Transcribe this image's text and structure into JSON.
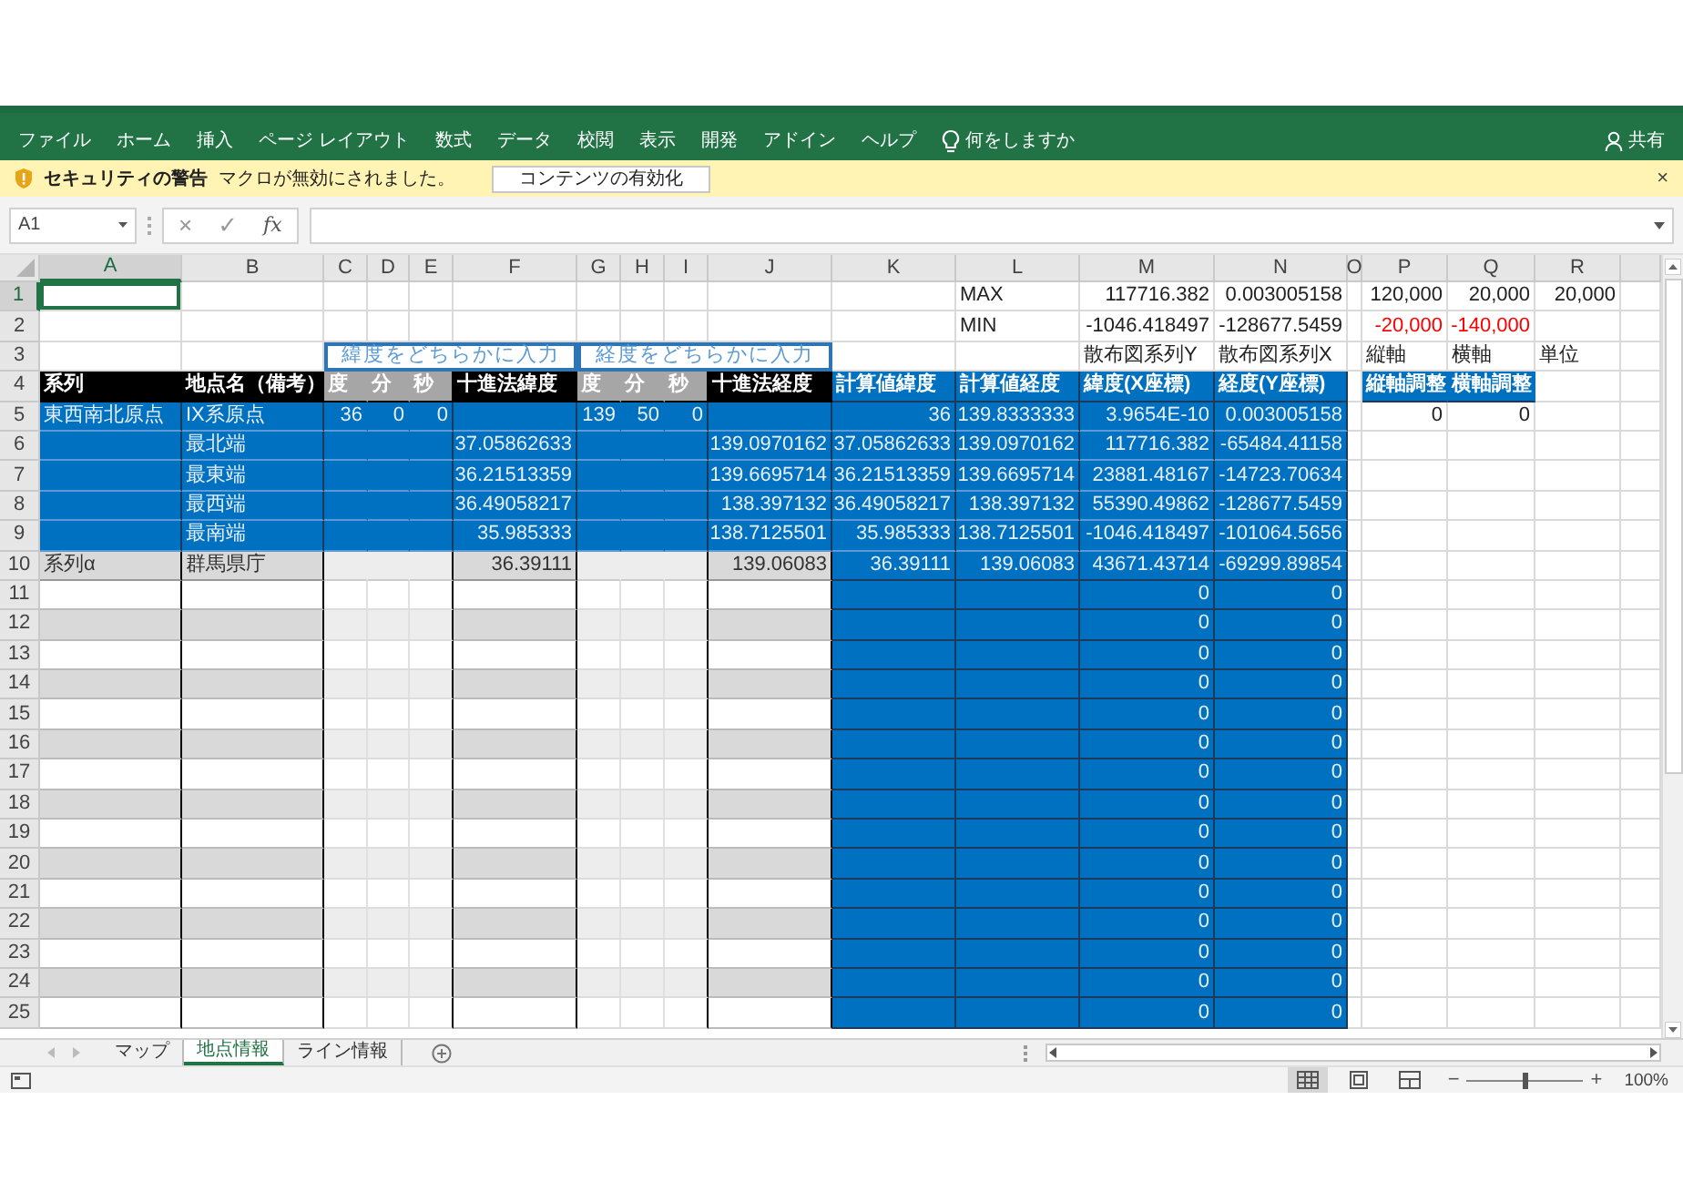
{
  "ribbon": {
    "tabs": [
      "ファイル",
      "ホーム",
      "挿入",
      "ページ レイアウト",
      "数式",
      "データ",
      "校閲",
      "表示",
      "開発",
      "アドイン",
      "ヘルプ"
    ],
    "tell_me": "何をしますか",
    "share": "共有"
  },
  "security_bar": {
    "title": "セキュリティの警告",
    "message": "マクロが無効にされました。",
    "button": "コンテンツの有効化",
    "close": "×"
  },
  "formula_bar": {
    "name_box": "A1",
    "cancel": "×",
    "enter": "✓",
    "function": "fx"
  },
  "sheet": {
    "columns": [
      {
        "letter": "A",
        "kind": "name",
        "selected": true
      },
      {
        "letter": "B",
        "kind": "name",
        "selected": false
      },
      {
        "letter": "C",
        "kind": "dms",
        "selected": false
      },
      {
        "letter": "D",
        "kind": "dms",
        "selected": false
      },
      {
        "letter": "E",
        "kind": "dms",
        "selected": false
      },
      {
        "letter": "F",
        "kind": "decimal",
        "selected": false
      },
      {
        "letter": "G",
        "kind": "dms",
        "selected": false
      },
      {
        "letter": "H",
        "kind": "dms",
        "selected": false
      },
      {
        "letter": "I",
        "kind": "dms",
        "selected": false
      },
      {
        "letter": "J",
        "kind": "decimal",
        "selected": false
      },
      {
        "letter": "K",
        "kind": "calc",
        "selected": false
      },
      {
        "letter": "L",
        "kind": "calc",
        "selected": false
      },
      {
        "letter": "M",
        "kind": "calc",
        "selected": false
      },
      {
        "letter": "N",
        "kind": "calc",
        "selected": false
      },
      {
        "letter": "O",
        "kind": "gap",
        "selected": false
      },
      {
        "letter": "P",
        "kind": "axis",
        "selected": false
      },
      {
        "letter": "Q",
        "kind": "axis",
        "selected": false
      },
      {
        "letter": "R",
        "kind": "plain",
        "selected": false
      }
    ],
    "rows": [
      {
        "number": "1",
        "kind": "plain",
        "selected": true,
        "cells": [
          "",
          "",
          "",
          "",
          "",
          "",
          "",
          "",
          "",
          "",
          "",
          {
            "text": "MAX",
            "kind": "label"
          },
          "117716.382",
          "0.003005158",
          "",
          "120,000",
          "20,000",
          "20,000"
        ]
      },
      {
        "number": "2",
        "kind": "plain",
        "selected": false,
        "cells": [
          "",
          "",
          "",
          "",
          "",
          "",
          "",
          "",
          "",
          "",
          "",
          {
            "text": "MIN",
            "kind": "label"
          },
          "-1046.418497",
          "-128677.5459",
          "",
          {
            "text": "-20,000",
            "color": "#ff0000"
          },
          {
            "text": "-140,000",
            "color": "#ff0000"
          },
          ""
        ]
      },
      {
        "number": "3",
        "kind": "label",
        "selected": false,
        "cells": [
          "",
          "",
          {
            "text": "緯度をどちらかに入力",
            "kind": "banner"
          },
          {
            "kind": "merged"
          },
          {
            "kind": "merged"
          },
          {
            "kind": "merged"
          },
          {
            "text": "経度をどちらかに入力",
            "kind": "banner"
          },
          {
            "kind": "merged"
          },
          {
            "kind": "merged"
          },
          {
            "kind": "merged"
          },
          "",
          "",
          "散布図系列Y",
          "散布図系列X",
          "",
          "縦軸",
          "横軸",
          "単位"
        ]
      },
      {
        "number": "4",
        "kind": "header",
        "selected": false,
        "cells": [
          "系列",
          "地点名（備考）",
          "度",
          "分",
          "秒",
          "十進法緯度",
          "度",
          "分",
          "秒",
          "十進法経度",
          "計算値緯度",
          "計算値経度",
          "緯度(X座標)",
          "経度(Y座標)",
          "",
          "縦軸調整",
          "横軸調整",
          ""
        ]
      },
      {
        "number": "5",
        "kind": "series",
        "selected": false,
        "cells": [
          "東西南北原点",
          "IX系原点",
          "36",
          "0",
          "0",
          "",
          "139",
          "50",
          "0",
          "",
          "36",
          "139.8333333",
          "3.9654E-10",
          "0.003005158",
          "",
          "0",
          "0",
          ""
        ]
      },
      {
        "number": "6",
        "kind": "series",
        "selected": false,
        "cells": [
          "",
          "最北端",
          "",
          "",
          "",
          "37.05862633",
          "",
          "",
          "",
          "139.0970162",
          "37.05862633",
          "139.0970162",
          "117716.382",
          "-65484.41158",
          "",
          "",
          "",
          ""
        ]
      },
      {
        "number": "7",
        "kind": "series",
        "selected": false,
        "cells": [
          "",
          "最東端",
          "",
          "",
          "",
          "36.21513359",
          "",
          "",
          "",
          "139.6695714",
          "36.21513359",
          "139.6695714",
          "23881.48167",
          "-14723.70634",
          "",
          "",
          "",
          ""
        ]
      },
      {
        "number": "8",
        "kind": "series",
        "selected": false,
        "cells": [
          "",
          "最西端",
          "",
          "",
          "",
          "36.49058217",
          "",
          "",
          "",
          "138.397132",
          "36.49058217",
          "138.397132",
          "55390.49862",
          "-128677.5459",
          "",
          "",
          "",
          ""
        ]
      },
      {
        "number": "9",
        "kind": "series",
        "selected": false,
        "cells": [
          "",
          "最南端",
          "",
          "",
          "",
          "35.985333",
          "",
          "",
          "",
          "138.7125501",
          "35.985333",
          "138.7125501",
          "-1046.418497",
          "-101064.5656",
          "",
          "",
          "",
          ""
        ]
      },
      {
        "number": "10",
        "kind": "alpha",
        "selected": false,
        "cells": [
          "系列α",
          "群馬県庁",
          "",
          "",
          "",
          "36.39111",
          "",
          "",
          "",
          "139.06083",
          "36.39111",
          "139.06083",
          "43671.43714",
          "-69299.89854",
          "",
          "",
          "",
          ""
        ]
      },
      {
        "number": "11",
        "kind": "entry-light",
        "selected": false,
        "cells": [
          "",
          "",
          "",
          "",
          "",
          "",
          "",
          "",
          "",
          "",
          "",
          "",
          "0",
          "0",
          "",
          "",
          "",
          ""
        ]
      },
      {
        "number": "12",
        "kind": "entry-dark",
        "selected": false,
        "cells": [
          "",
          "",
          "",
          "",
          "",
          "",
          "",
          "",
          "",
          "",
          "",
          "",
          "0",
          "0",
          "",
          "",
          "",
          ""
        ]
      },
      {
        "number": "13",
        "kind": "entry-light",
        "selected": false,
        "cells": [
          "",
          "",
          "",
          "",
          "",
          "",
          "",
          "",
          "",
          "",
          "",
          "",
          "0",
          "0",
          "",
          "",
          "",
          ""
        ]
      },
      {
        "number": "14",
        "kind": "entry-dark",
        "selected": false,
        "cells": [
          "",
          "",
          "",
          "",
          "",
          "",
          "",
          "",
          "",
          "",
          "",
          "",
          "0",
          "0",
          "",
          "",
          "",
          ""
        ]
      },
      {
        "number": "15",
        "kind": "entry-light",
        "selected": false,
        "cells": [
          "",
          "",
          "",
          "",
          "",
          "",
          "",
          "",
          "",
          "",
          "",
          "",
          "0",
          "0",
          "",
          "",
          "",
          ""
        ]
      },
      {
        "number": "16",
        "kind": "entry-dark",
        "selected": false,
        "cells": [
          "",
          "",
          "",
          "",
          "",
          "",
          "",
          "",
          "",
          "",
          "",
          "",
          "0",
          "0",
          "",
          "",
          "",
          ""
        ]
      },
      {
        "number": "17",
        "kind": "entry-light",
        "selected": false,
        "cells": [
          "",
          "",
          "",
          "",
          "",
          "",
          "",
          "",
          "",
          "",
          "",
          "",
          "0",
          "0",
          "",
          "",
          "",
          ""
        ]
      },
      {
        "number": "18",
        "kind": "entry-dark",
        "selected": false,
        "cells": [
          "",
          "",
          "",
          "",
          "",
          "",
          "",
          "",
          "",
          "",
          "",
          "",
          "0",
          "0",
          "",
          "",
          "",
          ""
        ]
      },
      {
        "number": "19",
        "kind": "entry-light",
        "selected": false,
        "cells": [
          "",
          "",
          "",
          "",
          "",
          "",
          "",
          "",
          "",
          "",
          "",
          "",
          "0",
          "0",
          "",
          "",
          "",
          ""
        ]
      },
      {
        "number": "20",
        "kind": "entry-dark",
        "selected": false,
        "cells": [
          "",
          "",
          "",
          "",
          "",
          "",
          "",
          "",
          "",
          "",
          "",
          "",
          "0",
          "0",
          "",
          "",
          "",
          ""
        ]
      },
      {
        "number": "21",
        "kind": "entry-light",
        "selected": false,
        "cells": [
          "",
          "",
          "",
          "",
          "",
          "",
          "",
          "",
          "",
          "",
          "",
          "",
          "0",
          "0",
          "",
          "",
          "",
          ""
        ]
      },
      {
        "number": "22",
        "kind": "entry-dark",
        "selected": false,
        "cells": [
          "",
          "",
          "",
          "",
          "",
          "",
          "",
          "",
          "",
          "",
          "",
          "",
          "0",
          "0",
          "",
          "",
          "",
          ""
        ]
      },
      {
        "number": "23",
        "kind": "entry-light",
        "selected": false,
        "cells": [
          "",
          "",
          "",
          "",
          "",
          "",
          "",
          "",
          "",
          "",
          "",
          "",
          "0",
          "0",
          "",
          "",
          "",
          ""
        ]
      },
      {
        "number": "24",
        "kind": "entry-dark",
        "selected": false,
        "cells": [
          "",
          "",
          "",
          "",
          "",
          "",
          "",
          "",
          "",
          "",
          "",
          "",
          "0",
          "0",
          "",
          "",
          "",
          ""
        ]
      },
      {
        "number": "25",
        "kind": "entry-light",
        "selected": false,
        "cells": [
          "",
          "",
          "",
          "",
          "",
          "",
          "",
          "",
          "",
          "",
          "",
          "",
          "0",
          "0",
          "",
          "",
          "",
          ""
        ]
      }
    ]
  },
  "sheet_tabs": [
    {
      "label": "マップ",
      "selected": false
    },
    {
      "label": "地点情報",
      "selected": true
    },
    {
      "label": "ライン情報",
      "selected": false
    }
  ],
  "status_bar": {
    "views": [
      {
        "kind": "normal",
        "selected": true
      },
      {
        "kind": "page-layout",
        "selected": false
      },
      {
        "kind": "page-break",
        "selected": false
      }
    ],
    "zoom_out": "−",
    "zoom_in": "+",
    "zoom_slider": {
      "level": 0.5
    },
    "zoom": "100%"
  }
}
